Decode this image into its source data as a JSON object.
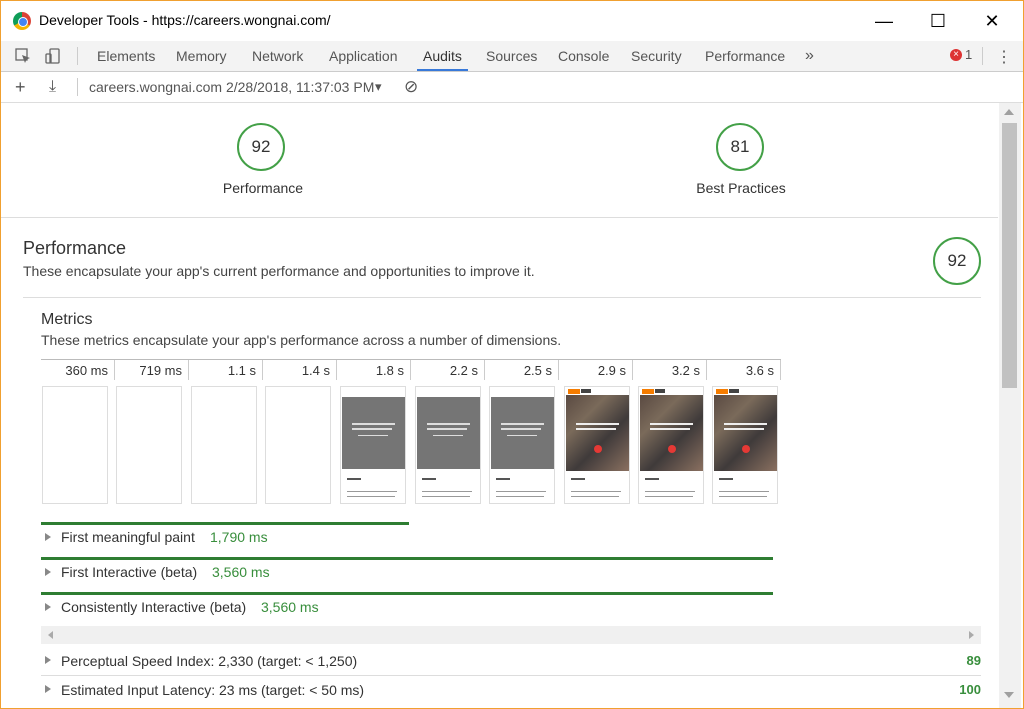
{
  "window": {
    "title": "Developer Tools - https://careers.wongnai.com/",
    "minimize": "—",
    "maximize": "☐",
    "close": "✕"
  },
  "tabs": [
    "Elements",
    "Memory",
    "Network",
    "Application",
    "Audits",
    "Sources",
    "Console",
    "Security",
    "Performance"
  ],
  "tabs_more": "»",
  "active_tab": "Audits",
  "errors": {
    "icon": "×",
    "count": "1"
  },
  "menu": "⋮",
  "audit_bar": {
    "add": "+",
    "download": "⤓",
    "report_label": "careers.wongnai.com 2/28/2018, 11:37:03 PM",
    "dropdown": "▾",
    "block": "⊘"
  },
  "summary": [
    {
      "score": "92",
      "label": "Performance"
    },
    {
      "score": "81",
      "label": "Best Practices"
    }
  ],
  "performance": {
    "title": "Performance",
    "description": "These encapsulate your app's current performance and opportunities to improve it.",
    "score": "92"
  },
  "metrics": {
    "title": "Metrics",
    "description": "These metrics encapsulate your app's performance across a number of dimensions.",
    "timeline_ticks": [
      "360 ms",
      "719 ms",
      "1.1 s",
      "1.4 s",
      "1.8 s",
      "2.2 s",
      "2.5 s",
      "2.9 s",
      "3.2 s",
      "3.6 s"
    ],
    "frames": [
      "blank",
      "blank",
      "blank",
      "blank",
      "grey",
      "grey",
      "grey",
      "photo",
      "photo",
      "photo"
    ],
    "rows": [
      {
        "label": "First meaningful paint",
        "value": "1,790 ms",
        "bar_fraction": 0.497
      },
      {
        "label": "First Interactive (beta)",
        "value": "3,560 ms",
        "bar_fraction": 0.989
      },
      {
        "label": "Consistently Interactive (beta)",
        "value": "3,560 ms",
        "bar_fraction": 0.989
      }
    ]
  },
  "scored_metrics": [
    {
      "label": "Perceptual Speed Index: 2,330 (target: < 1,250)",
      "score": "89"
    },
    {
      "label": "Estimated Input Latency: 23 ms (target: < 50 ms)",
      "score": "100"
    }
  ],
  "colors": {
    "accent": "#3879d9",
    "pass": "#43a047",
    "bar": "#2e7d32",
    "window_border": "#f0a030"
  }
}
